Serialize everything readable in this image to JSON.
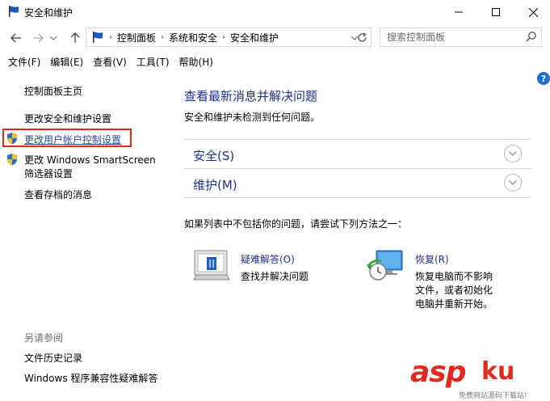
{
  "window": {
    "title": "安全和维护"
  },
  "address_bar": {
    "breadcrumbs": [
      "控制面板",
      "系统和安全",
      "安全和维护"
    ],
    "search_placeholder": "搜索控制面板"
  },
  "menu": {
    "items": [
      "文件(F)",
      "编辑(E)",
      "查看(V)",
      "工具(T)",
      "帮助(H)"
    ]
  },
  "sidebar": {
    "home": "控制面板主页",
    "links": [
      "更改安全和维护设置",
      "更改用户帐户控制设置",
      "更改 Windows SmartScreen",
      "筛选器设置",
      "查看存档的消息"
    ],
    "see_also_heading": "另请参阅",
    "see_also": [
      "文件历史记录",
      "Windows 程序兼容性疑难解答"
    ]
  },
  "main": {
    "title": "查看最新消息并解决问题",
    "description": "安全和维护未检测到任何问题。",
    "sections": [
      "安全(S)",
      "维护(M)"
    ],
    "other_text": "如果列表中不包括你的问题，请尝试下列方法之一：",
    "tools": [
      {
        "label": "疑难解答(O)",
        "description": [
          "查找并解决问题"
        ]
      },
      {
        "label": "恢复(R)",
        "description": [
          "恢复电脑而不影响",
          "文件，或者初始化",
          "电脑并重新开始。"
        ]
      }
    ]
  },
  "watermark": {
    "brand": "asp",
    "brand_cn": "ku",
    "sub": "免费网站源码下载站!"
  },
  "colors": {
    "link_blue": "#1e3287",
    "highlight_red": "#e0281e",
    "watermark_red": "#e02a1d"
  }
}
